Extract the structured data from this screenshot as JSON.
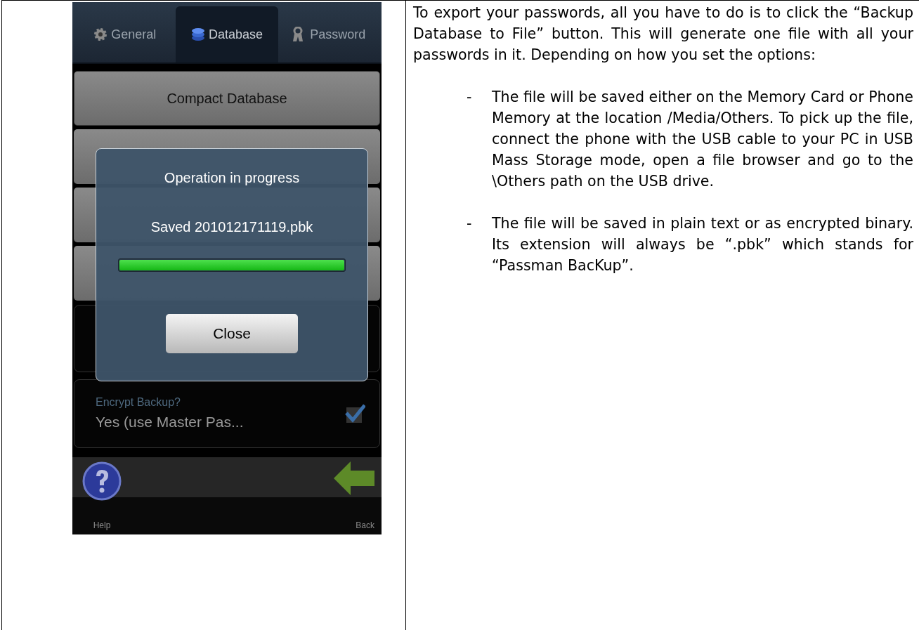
{
  "phone": {
    "tabs": [
      {
        "label": "General",
        "selected": false
      },
      {
        "label": "Database",
        "selected": true
      },
      {
        "label": "Password",
        "selected": false
      }
    ],
    "buttons": [
      {
        "label": "Compact Database"
      }
    ],
    "encrypt": {
      "label": "Encrypt Backup?",
      "value": "Yes (use Master Pas...",
      "checked": true
    },
    "toolbar": [
      {
        "label": "Help"
      },
      {
        "label": "Back"
      }
    ],
    "dialog": {
      "title": "Operation in progress",
      "message": "Saved 201012171119.pbk",
      "level": 1,
      "button": "Close"
    }
  },
  "text": {
    "intro": "To export your passwords, all you have to do is to click the “Backup Database to File” button. This will generate one file with all your passwords in it. Depending on how you set the options:",
    "items": [
      {
        "marker": "-",
        "text": "The file will be saved either on the Memory Card or Phone Memory at the location /Media/Others. To pick up the file, connect the phone with the USB cable to your PC in USB Mass Storage mode, open a file browser and go to the \\Others path on the USB drive."
      },
      {
        "marker": "-",
        "text": "The file will be saved in plain text or as encrypted binary. Its extension will always be “.pbk” which stands for “Passman BacKup”."
      }
    ]
  }
}
